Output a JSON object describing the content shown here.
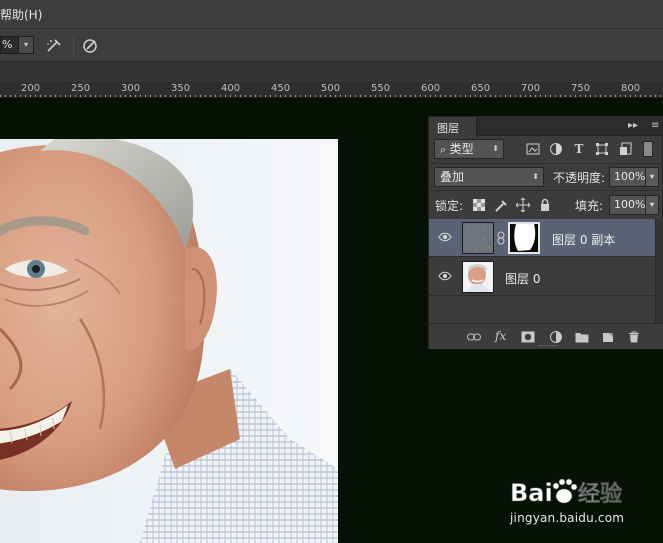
{
  "menubar": {
    "partial_item": "帮助(H)"
  },
  "optionsbar": {
    "percent_value": "%",
    "dropdown_glyph": "▾"
  },
  "ruler": {
    "ticks": [
      "200",
      "250",
      "300",
      "350",
      "400",
      "450",
      "500",
      "550",
      "600",
      "650",
      "700",
      "750",
      "800"
    ]
  },
  "layers_panel": {
    "tab_label": "图层",
    "collapse_glyph": "▸▸",
    "menu_glyph": "≡",
    "filter_kind": "类型",
    "blend_mode": "叠加",
    "opacity_label": "不透明度:",
    "opacity_value": "100%",
    "lock_label": "锁定:",
    "fill_label": "填充:",
    "fill_value": "100%",
    "layers": [
      {
        "name": "图层 0 副本",
        "selected": true
      },
      {
        "name": "图层 0",
        "selected": false
      }
    ],
    "footer_icons": [
      "link-icon",
      "fx-icon",
      "mask-icon",
      "adjustment-icon",
      "folder-icon",
      "new-layer-icon",
      "trash-icon"
    ]
  },
  "watermark": {
    "brand": "Baidu经验",
    "url": "jingyan.baidu.com"
  },
  "colors": {
    "app_bg": "#3d3d3d",
    "canvas_bg": "#061206",
    "selected_layer": "#596375"
  }
}
